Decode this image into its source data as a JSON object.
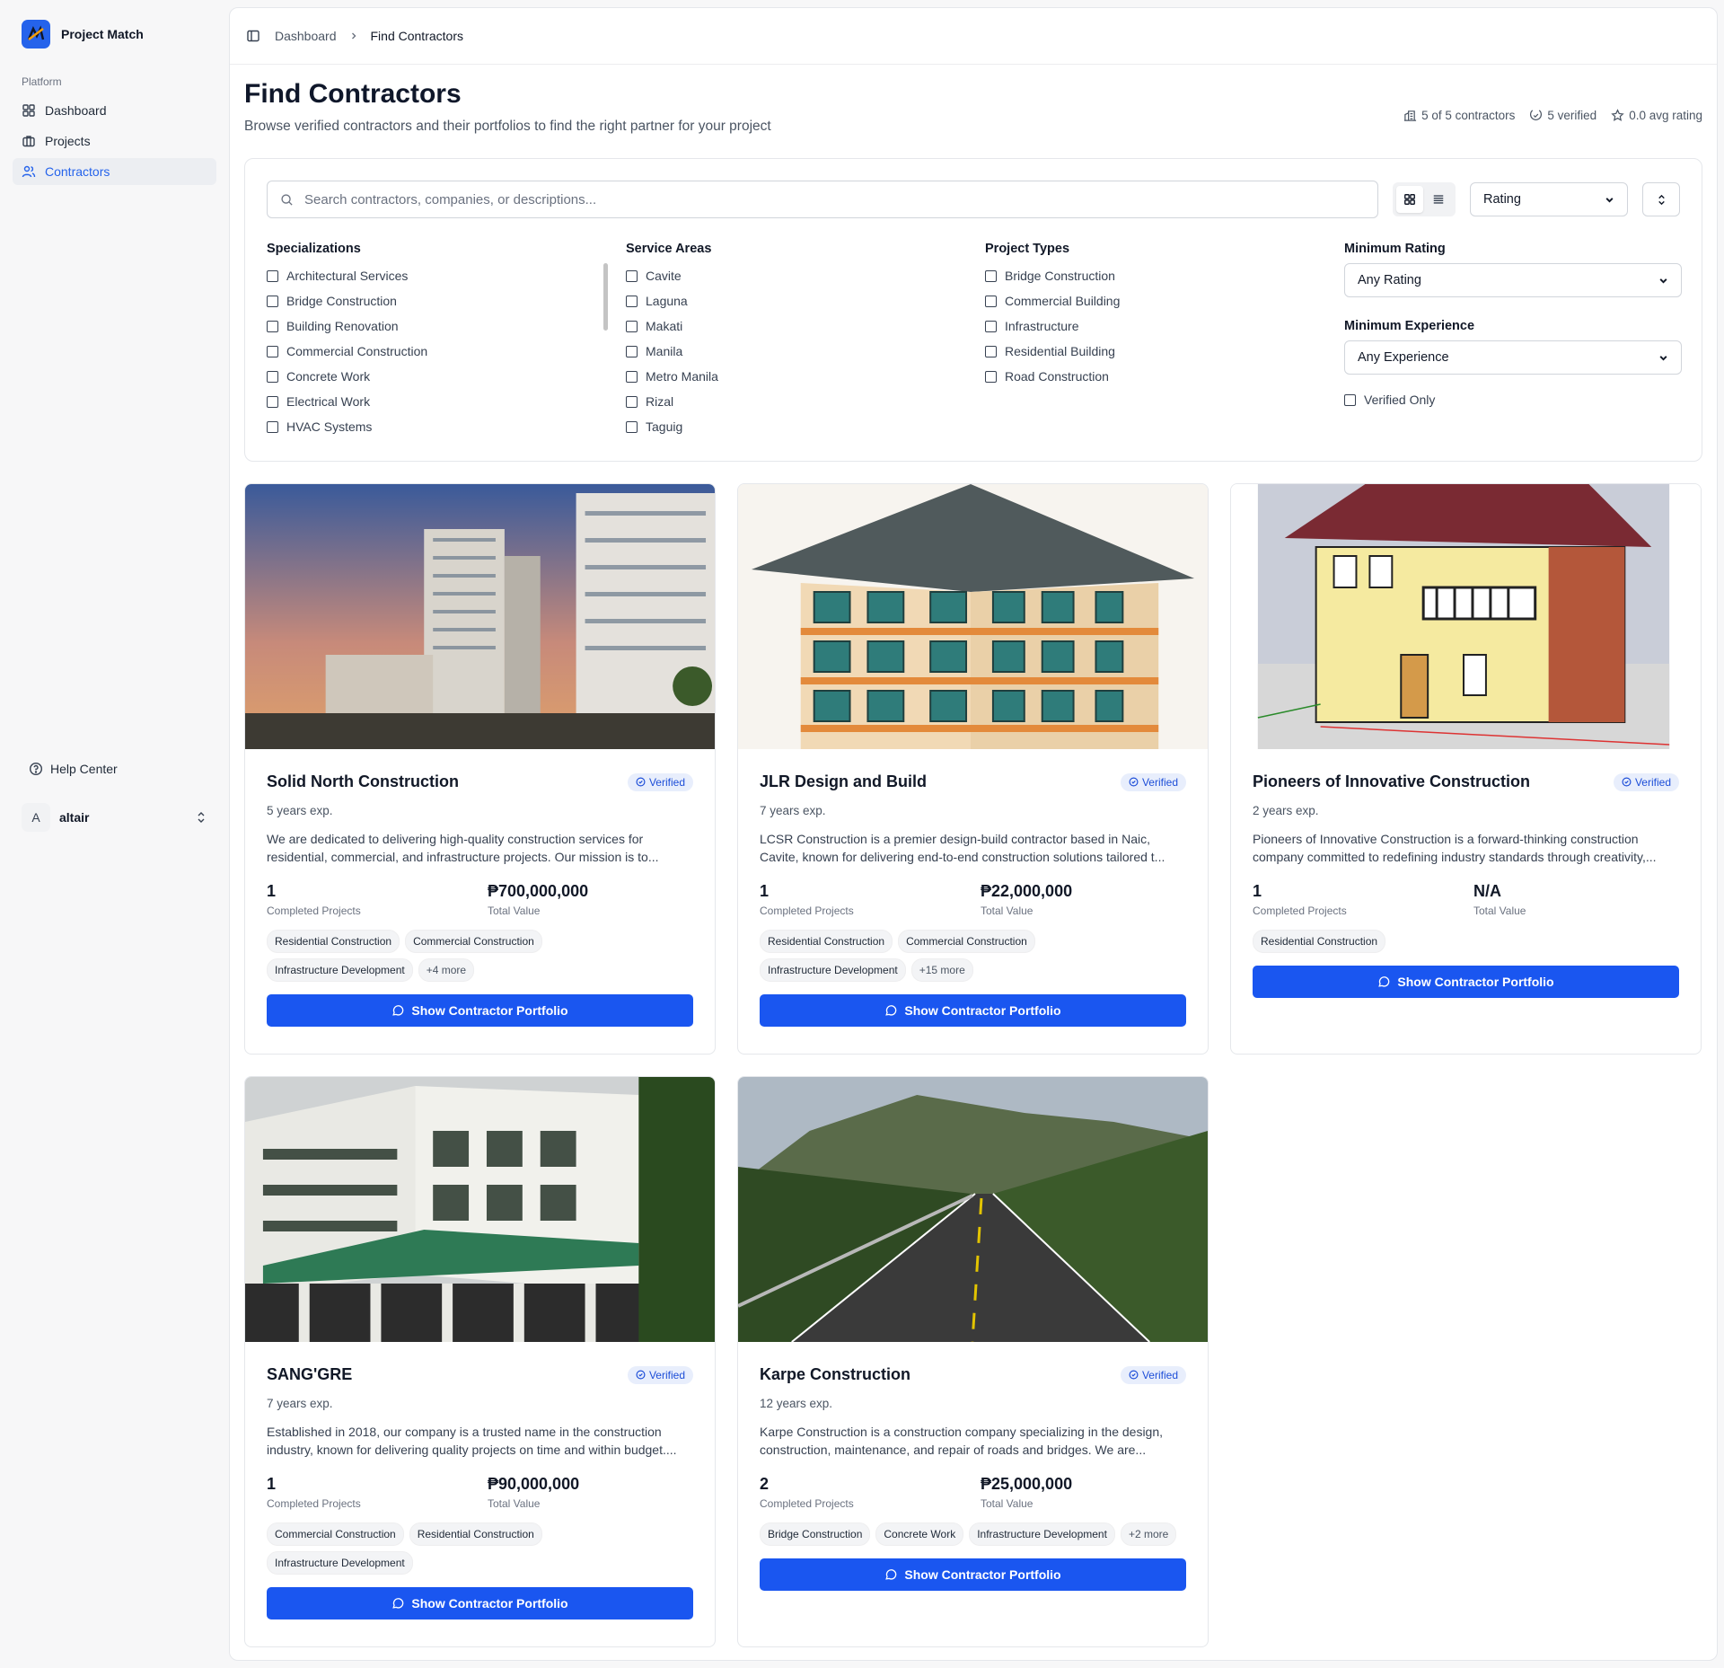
{
  "app": {
    "name": "Project Match"
  },
  "sidebar": {
    "group_label": "Platform",
    "items": [
      {
        "label": "Dashboard",
        "icon": "grid-icon"
      },
      {
        "label": "Projects",
        "icon": "briefcase-icon"
      },
      {
        "label": "Contractors",
        "icon": "users-icon",
        "active": true
      }
    ],
    "help": "Help Center",
    "user": {
      "initial": "A",
      "name": "altair"
    }
  },
  "breadcrumb": {
    "parent": "Dashboard",
    "current": "Find Contractors"
  },
  "page": {
    "title": "Find Contractors",
    "subtitle": "Browse verified contractors and their portfolios to find the right partner for your project",
    "stats": {
      "count": "5 of 5 contractors",
      "verified": "5 verified",
      "rating": "0.0 avg rating"
    }
  },
  "filters": {
    "search_placeholder": "Search contractors, companies, or descriptions...",
    "sort": "Rating",
    "specializations": {
      "label": "Specializations",
      "items": [
        "Architectural Services",
        "Bridge Construction",
        "Building Renovation",
        "Commercial Construction",
        "Concrete Work",
        "Electrical Work",
        "HVAC Systems"
      ]
    },
    "service_areas": {
      "label": "Service Areas",
      "items": [
        "Cavite",
        "Laguna",
        "Makati",
        "Manila",
        "Metro Manila",
        "Rizal",
        "Taguig"
      ]
    },
    "project_types": {
      "label": "Project Types",
      "items": [
        "Bridge Construction",
        "Commercial Building",
        "Infrastructure",
        "Residential Building",
        "Road Construction"
      ]
    },
    "min_rating": {
      "label": "Minimum Rating",
      "value": "Any Rating"
    },
    "min_experience": {
      "label": "Minimum Experience",
      "value": "Any Experience"
    },
    "verified_only": "Verified Only"
  },
  "card_labels": {
    "badge": "Verified",
    "completed": "Completed Projects",
    "value": "Total Value",
    "button": "Show Contractor Portfolio"
  },
  "contractors": [
    {
      "name": "Solid North Construction",
      "exp": "5 years exp.",
      "desc": "We are dedicated to delivering high-quality construction services for residential, commercial, and infrastructure projects. Our mission is to...",
      "completed": "1",
      "value": "₱700,000,000",
      "tags": [
        "Residential Construction",
        "Commercial Construction",
        "Infrastructure Development",
        "+4 more"
      ]
    },
    {
      "name": "JLR Design and Build",
      "exp": "7 years exp.",
      "desc": "LCSR Construction is a premier design-build contractor based in Naic, Cavite, known for delivering end-to-end construction solutions tailored t...",
      "completed": "1",
      "value": "₱22,000,000",
      "tags": [
        "Residential Construction",
        "Commercial Construction",
        "Infrastructure Development",
        "+15 more"
      ]
    },
    {
      "name": "Pioneers of Innovative Construction",
      "exp": "2 years exp.",
      "desc": "Pioneers of Innovative Construction is a forward-thinking construction company committed to redefining industry standards through creativity,...",
      "completed": "1",
      "value": "N/A",
      "tags": [
        "Residential Construction"
      ]
    },
    {
      "name": "SANG'GRE",
      "exp": "7 years exp.",
      "desc": "Established in 2018, our company is a trusted name in the construction industry, known for delivering quality projects on time and within budget....",
      "completed": "1",
      "value": "₱90,000,000",
      "tags": [
        "Commercial Construction",
        "Residential Construction",
        "Infrastructure Development"
      ]
    },
    {
      "name": "Karpe Construction",
      "exp": "12 years exp.",
      "desc": "Karpe Construction is a construction company specializing in the design, construction, maintenance, and repair of roads and bridges. We are...",
      "completed": "2",
      "value": "₱25,000,000",
      "tags": [
        "Bridge Construction",
        "Concrete Work",
        "Infrastructure Development",
        "+2 more"
      ]
    }
  ],
  "colors": {
    "accent": "#1a56f0",
    "badge_bg": "#e8eefc",
    "active_nav": "#2563eb"
  }
}
